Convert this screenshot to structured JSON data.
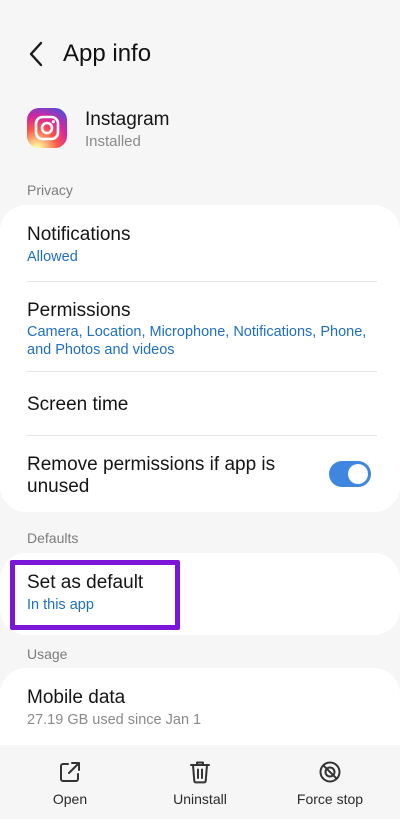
{
  "header": {
    "title": "App info"
  },
  "app": {
    "name": "Instagram",
    "status": "Installed"
  },
  "sections": {
    "privacy": "Privacy",
    "defaults": "Defaults",
    "usage": "Usage"
  },
  "privacy_items": {
    "notifications": {
      "title": "Notifications",
      "sub": "Allowed"
    },
    "permissions": {
      "title": "Permissions",
      "sub": "Camera, Location, Microphone, Notifications, Phone, and Photos and videos"
    },
    "screen_time": {
      "title": "Screen time"
    },
    "remove_permissions": {
      "title_line1": "Remove permissions if app is",
      "title_line2": "unused",
      "enabled": true
    }
  },
  "defaults_items": {
    "set_default": {
      "title": "Set as default",
      "sub": "In this app"
    }
  },
  "usage_items": {
    "mobile_data": {
      "title": "Mobile data",
      "sub": "27.19 GB used since Jan 1"
    }
  },
  "bottom_actions": {
    "open": "Open",
    "uninstall": "Uninstall",
    "force_stop": "Force stop"
  },
  "colors": {
    "accent_blue": "#1f6fbf",
    "toggle_on": "#3e86e0",
    "highlight": "#7b16d9",
    "background": "#f6f6f6"
  }
}
